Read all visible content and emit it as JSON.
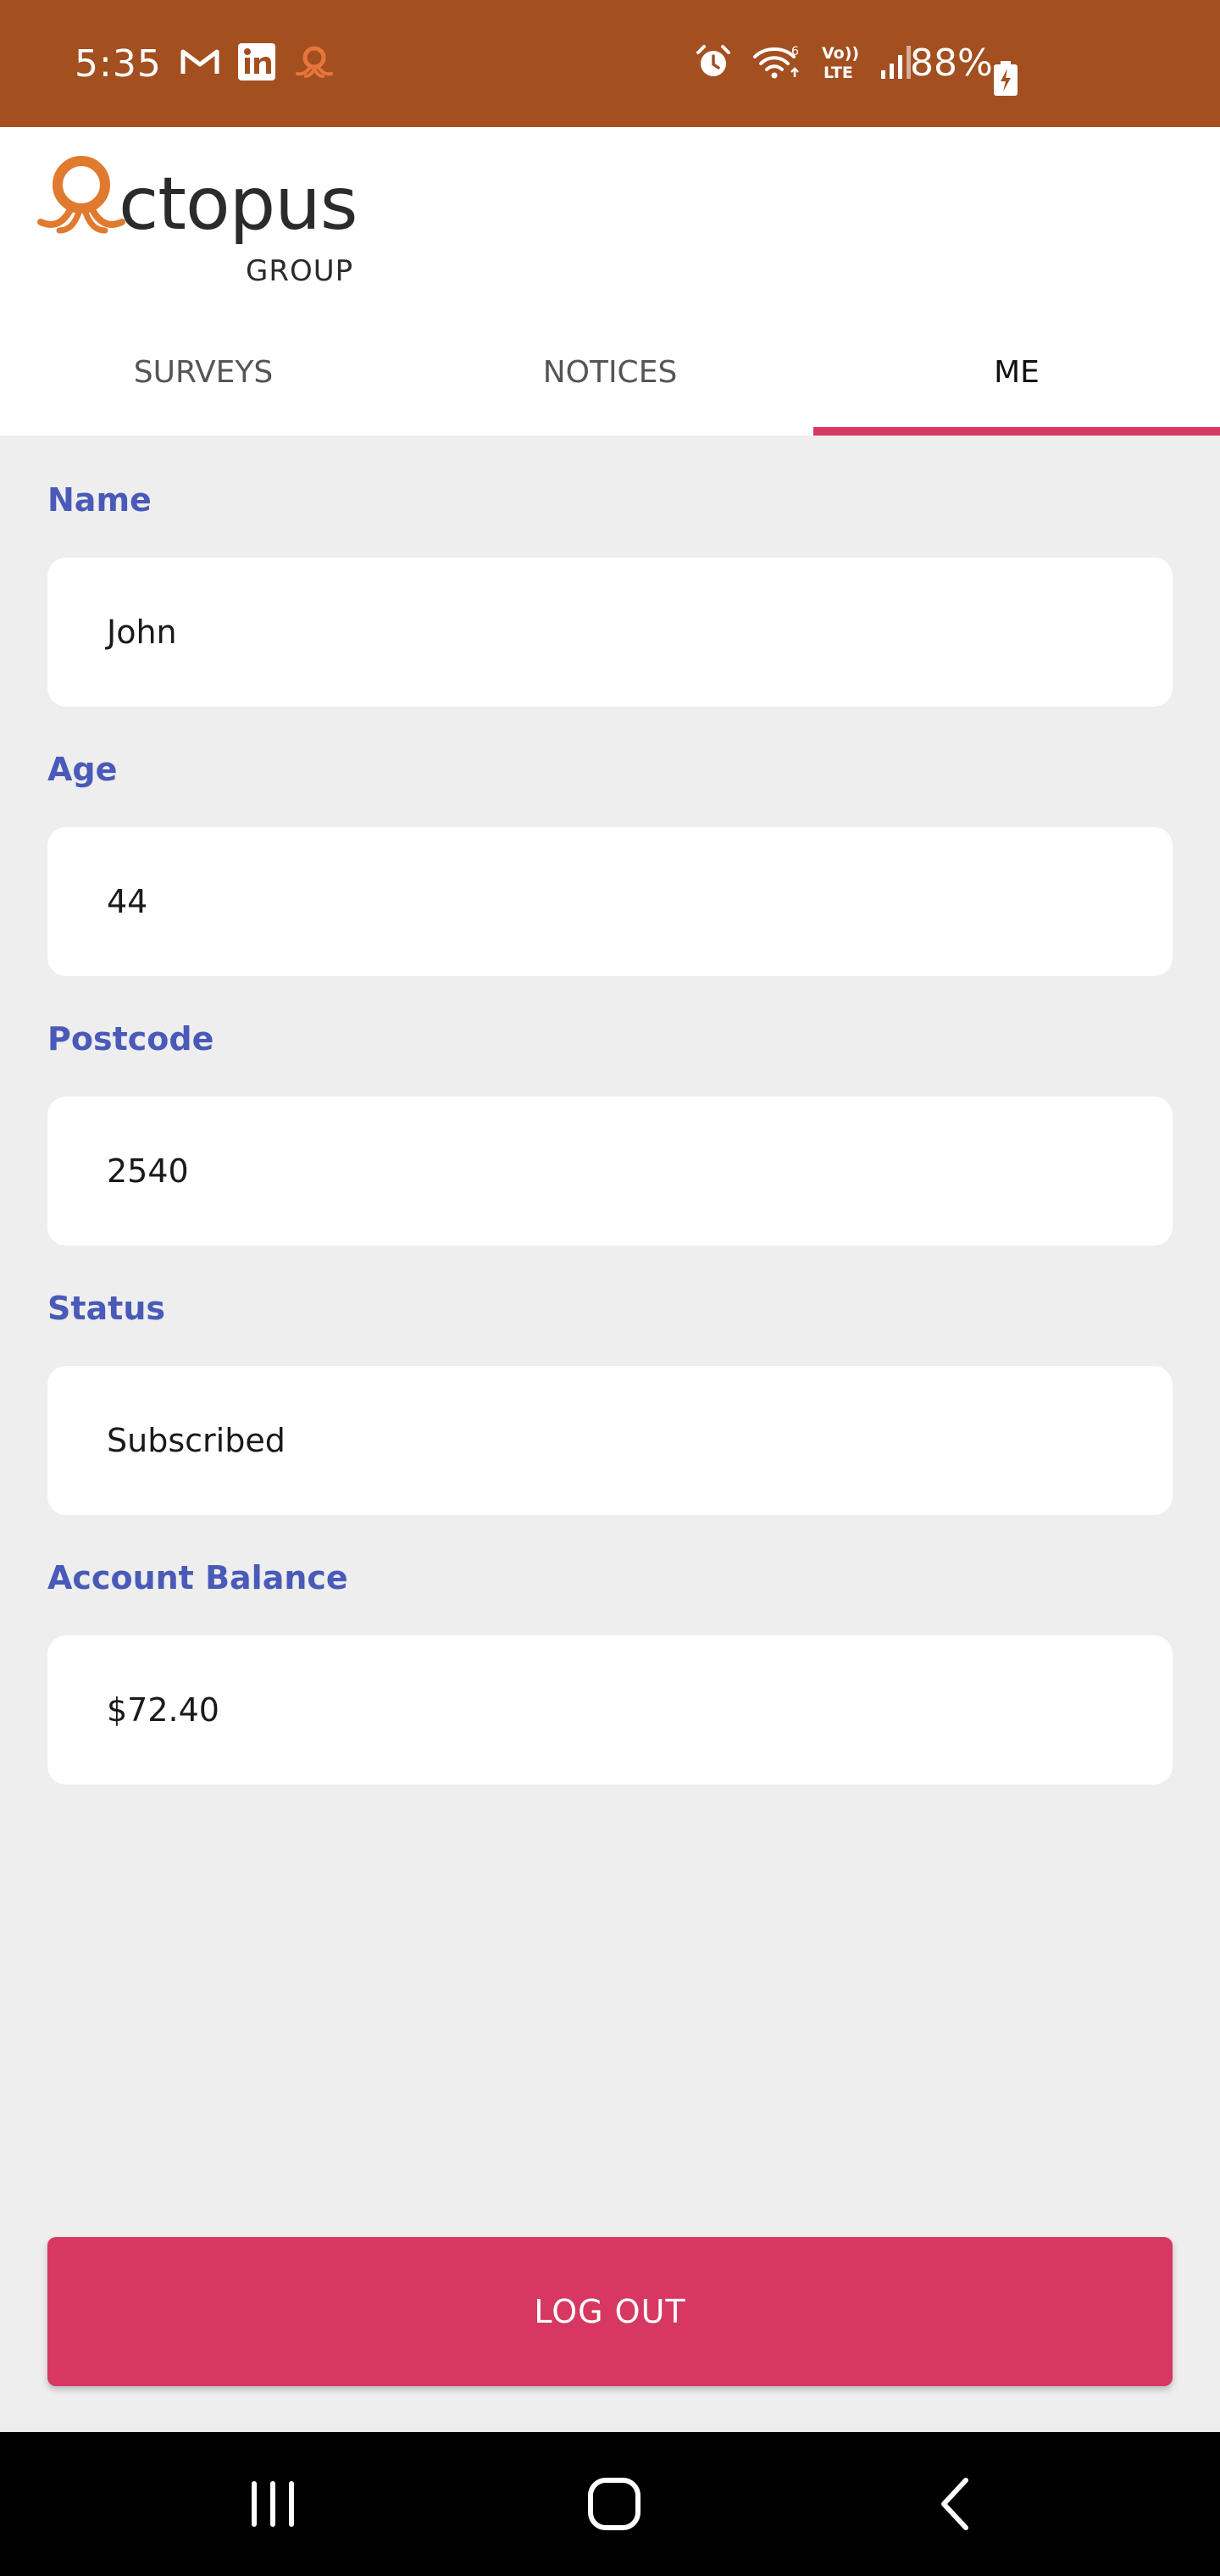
{
  "status_bar": {
    "time": "5:35",
    "battery": "88%",
    "colors": {
      "background": "#a34f20"
    },
    "left_icons": [
      "gmail-icon",
      "linkedin-icon",
      "octopus-app-icon"
    ],
    "right_icons": [
      "alarm-icon",
      "wifi-icon",
      "volte-icon",
      "signal-icon",
      "battery-charging-icon"
    ]
  },
  "header": {
    "logo_word": "ctopus",
    "logo_sub": "GROUP"
  },
  "tabs": [
    {
      "label": "SURVEYS",
      "active": false
    },
    {
      "label": "NOTICES",
      "active": false
    },
    {
      "label": "ME",
      "active": true
    }
  ],
  "form": {
    "fields": [
      {
        "label": "Name",
        "value": "John"
      },
      {
        "label": "Age",
        "value": "44"
      },
      {
        "label": "Postcode",
        "value": "2540"
      },
      {
        "label": "Status",
        "value": "Subscribed"
      },
      {
        "label": "Account Balance",
        "value": "$72.40"
      }
    ]
  },
  "logout_label": "LOG OUT",
  "nav_bar": {
    "icons": [
      "recent-apps-icon",
      "home-icon",
      "back-icon"
    ]
  },
  "colors": {
    "accent": "#d63862",
    "label": "#4a5ab8",
    "logo": "#e07a2e",
    "page_bg": "#eeeeee"
  }
}
